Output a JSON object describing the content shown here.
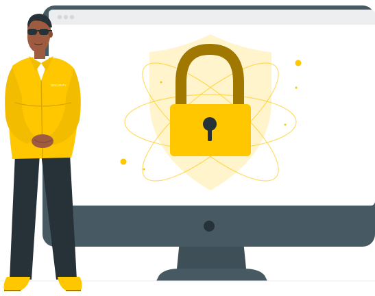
{
  "illustration": {
    "security_badge_text": "SECURITY",
    "browser_dots": [
      "dot-1",
      "dot-2",
      "dot-3"
    ],
    "icons": {
      "lock": "padlock-icon",
      "shield": "shield-icon",
      "orbit": "atom-orbit-icon"
    },
    "colors": {
      "accent_yellow": "#FFC700",
      "padlock_shackle": "#A07800",
      "monitor_body": "#475A63",
      "screen": "#FFFFFF",
      "browser_bar": "#ECEEF0",
      "jacket": "#FFC700",
      "pants": "#263238",
      "skin": "#9E5B3F"
    }
  }
}
